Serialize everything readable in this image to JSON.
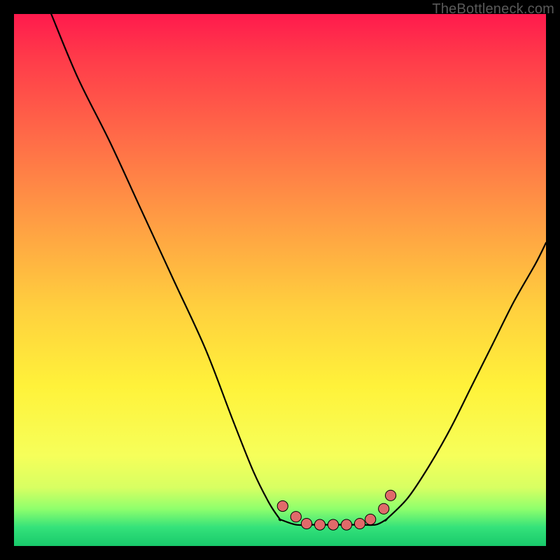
{
  "watermark": "TheBottleneck.com",
  "colors": {
    "frame": "#000000",
    "gradient_top": "#ff1a4d",
    "gradient_mid": "#fff23a",
    "gradient_bottom": "#18c96b",
    "curve_stroke": "#000000",
    "marker_fill": "#e06a6a",
    "marker_stroke": "#000000"
  },
  "chart_data": {
    "type": "line",
    "title": "",
    "xlabel": "",
    "ylabel": "",
    "xlim": [
      0,
      100
    ],
    "ylim": [
      0,
      100
    ],
    "note": "V-shaped bottleneck curve. y ≈ 100 is worst (red top), y ≈ 0 is best (green bottom). Flat plateau at bottom with dotted markers.",
    "series": [
      {
        "name": "left_arm",
        "x": [
          7,
          12,
          18,
          24,
          30,
          36,
          41,
          45,
          48,
          50
        ],
        "y": [
          100,
          88,
          76,
          63,
          50,
          37,
          24,
          14,
          8,
          5
        ]
      },
      {
        "name": "plateau",
        "x": [
          50,
          53,
          56,
          59,
          62,
          65,
          68,
          70
        ],
        "y": [
          5,
          4,
          4,
          4,
          4,
          4,
          4,
          5
        ]
      },
      {
        "name": "right_arm",
        "x": [
          70,
          74,
          78,
          82,
          86,
          90,
          94,
          98,
          100
        ],
        "y": [
          5,
          9,
          15,
          22,
          30,
          38,
          46,
          53,
          57
        ]
      }
    ],
    "markers": {
      "name": "bottom_dots",
      "color": "#e06a6a",
      "radius_pct": 1.0,
      "points_x": [
        50.5,
        53,
        55,
        57.5,
        60,
        62.5,
        65,
        67,
        69.5,
        70.8
      ],
      "points_y": [
        7.5,
        5.5,
        4.2,
        4.0,
        4.0,
        4.0,
        4.2,
        5.0,
        7.0,
        9.5
      ]
    }
  }
}
